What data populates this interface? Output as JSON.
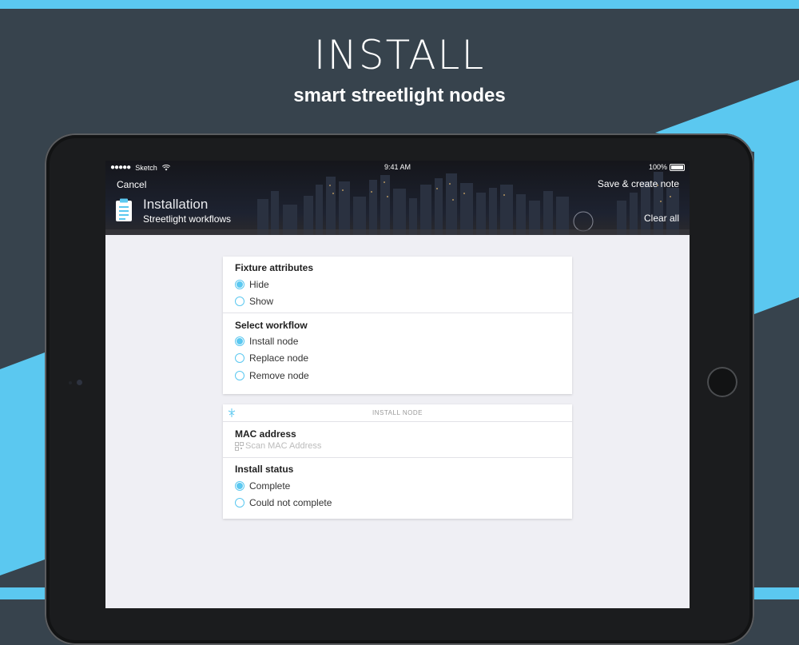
{
  "promo": {
    "title": "INSTALL",
    "subtitle": "smart streetlight nodes"
  },
  "colors": {
    "background": "#37434d",
    "accent": "#5bc8f0",
    "radio": "#5bc8f0"
  },
  "status_bar": {
    "carrier": "Sketch",
    "time": "9:41 AM",
    "battery": "100%"
  },
  "nav": {
    "cancel": "Cancel",
    "save_note": "Save & create note",
    "clear_all": "Clear all",
    "title": "Installation",
    "subtitle": "Streetlight workflows"
  },
  "fixture": {
    "label": "Fixture attributes",
    "options": [
      {
        "label": "Hide",
        "selected": true
      },
      {
        "label": "Show",
        "selected": false
      }
    ]
  },
  "workflow": {
    "label": "Select workflow",
    "options": [
      {
        "label": "Install node",
        "selected": true
      },
      {
        "label": "Replace node",
        "selected": false
      },
      {
        "label": "Remove node",
        "selected": false
      }
    ]
  },
  "install_node": {
    "header": "INSTALL NODE",
    "mac_label": "MAC address",
    "mac_placeholder": "Scan MAC Address",
    "status_label": "Install status",
    "status_options": [
      {
        "label": "Complete",
        "selected": true
      },
      {
        "label": "Could not complete",
        "selected": false
      }
    ]
  }
}
